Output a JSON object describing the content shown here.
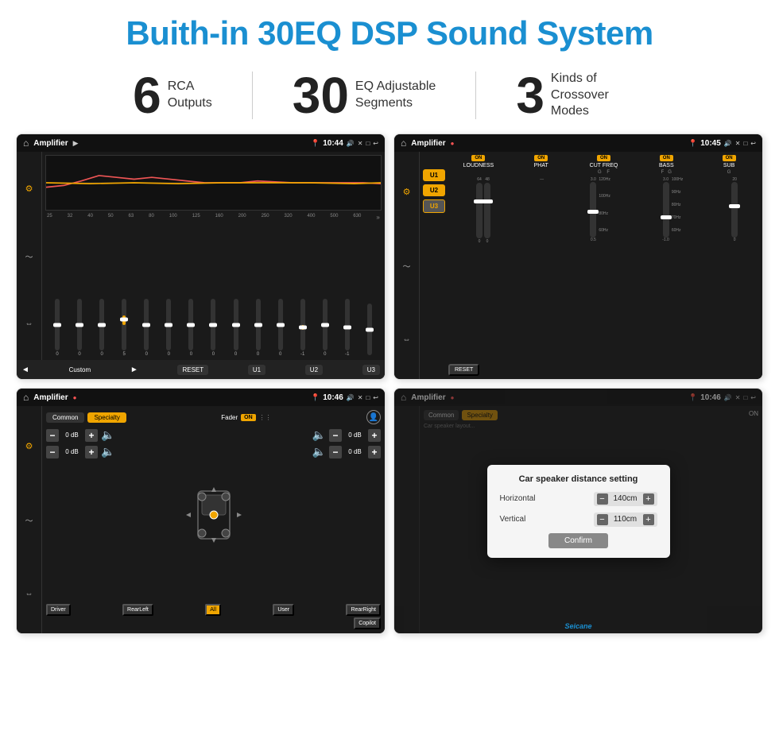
{
  "header": {
    "title": "Buith-in 30EQ DSP Sound System"
  },
  "stats": [
    {
      "number": "6",
      "label": "RCA\nOutputs"
    },
    {
      "number": "30",
      "label": "EQ Adjustable\nSegments"
    },
    {
      "number": "3",
      "label": "Kinds of\nCrossover Modes"
    }
  ],
  "screens": [
    {
      "id": "eq-screen",
      "statusBar": {
        "title": "Amplifier",
        "time": "10:44"
      }
    },
    {
      "id": "amp-screen",
      "statusBar": {
        "title": "Amplifier",
        "time": "10:45"
      }
    },
    {
      "id": "fader-screen",
      "statusBar": {
        "title": "Amplifier",
        "time": "10:46"
      }
    },
    {
      "id": "dist-screen",
      "statusBar": {
        "title": "Amplifier",
        "time": "10:46"
      },
      "dialog": {
        "title": "Car speaker distance setting",
        "fields": [
          {
            "label": "Horizontal",
            "value": "140cm"
          },
          {
            "label": "Vertical",
            "value": "110cm"
          }
        ],
        "confirmLabel": "Confirm"
      }
    }
  ],
  "eq": {
    "frequencies": [
      "25",
      "32",
      "40",
      "50",
      "63",
      "80",
      "100",
      "125",
      "160",
      "200",
      "250",
      "320",
      "400",
      "500",
      "630"
    ],
    "values": [
      "0",
      "0",
      "0",
      "5",
      "0",
      "0",
      "0",
      "0",
      "0",
      "0",
      "0",
      "-1",
      "0",
      "-1",
      ""
    ],
    "presets": [
      "RESET",
      "U1",
      "U2",
      "U3"
    ],
    "customLabel": "Custom"
  },
  "amp": {
    "channels": [
      "LOUDNESS",
      "PHAT",
      "CUT FREQ",
      "BASS",
      "SUB"
    ],
    "uButtons": [
      "U1",
      "U2",
      "U3"
    ],
    "resetLabel": "RESET"
  },
  "fader": {
    "tabs": [
      "Common",
      "Specialty"
    ],
    "faderLabel": "Fader",
    "positionButtons": [
      "Driver",
      "RearLeft",
      "All",
      "User",
      "RearRight",
      "Copilot"
    ],
    "dbValues": [
      "0 dB",
      "0 dB",
      "0 dB",
      "0 dB"
    ]
  },
  "watermark": "Seicane"
}
